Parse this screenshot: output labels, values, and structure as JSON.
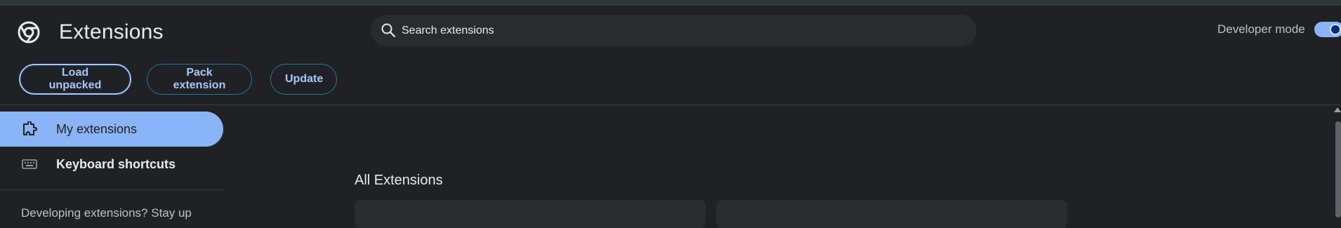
{
  "header": {
    "title": "Extensions",
    "logo_icon": "chrome-logo-icon",
    "search": {
      "placeholder": "Search extensions",
      "value": "",
      "icon": "search-icon"
    },
    "developer_mode": {
      "label": "Developer mode",
      "enabled": true
    }
  },
  "toolbar": {
    "load_unpacked": "Load unpacked",
    "pack_extension": "Pack extension",
    "update": "Update"
  },
  "sidebar": {
    "items": [
      {
        "label": "My extensions",
        "icon": "extension-puzzle-icon",
        "active": true
      },
      {
        "label": "Keyboard shortcuts",
        "icon": "keyboard-icon",
        "active": false
      }
    ],
    "promo_text": "Developing extensions? Stay up"
  },
  "main": {
    "section_title": "All Extensions"
  },
  "colors": {
    "background": "#202124",
    "accent": "#8ab4f8",
    "button_text": "#a8c7fa",
    "button_border": "#1f7a9a"
  }
}
